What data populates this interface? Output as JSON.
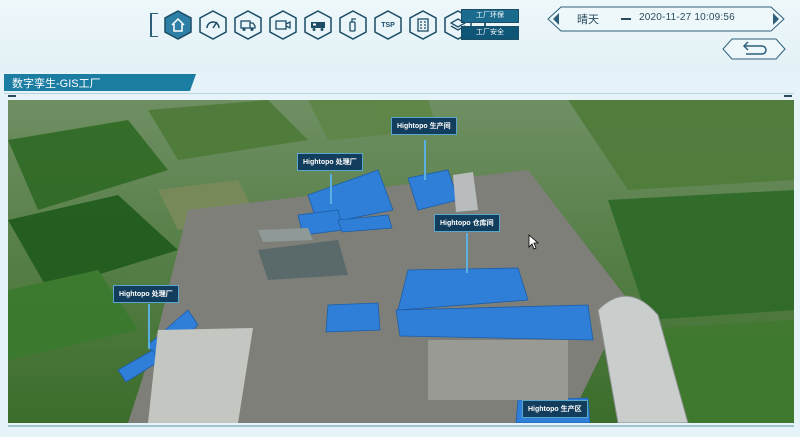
{
  "toolbar": {
    "icons": [
      "home-icon",
      "gauge-icon",
      "truck-icon",
      "camera-icon",
      "fire-truck-icon",
      "extinguisher-icon",
      "tsp-icon",
      "building-icon",
      "layers-icon"
    ],
    "tsp_label": "TSP"
  },
  "switches": {
    "env_label": "工厂环保",
    "safety_label": "工厂安全"
  },
  "status": {
    "weather": "晴天",
    "datetime": "2020-11-27 10:09:56"
  },
  "page": {
    "title": "数字孪生-GIS工厂"
  },
  "map_labels": {
    "production_hall_top": "Hightopo 生产间",
    "treatment_plant_top": "Hightopo 处理厂",
    "warehouse": "Hightopo 仓库间",
    "treatment_plant_left": "Hightopo 处理厂",
    "production_area": "Hightopo 生产区"
  },
  "colors": {
    "accent": "#1c7da3",
    "roof_blue": "#2f7fd8",
    "label_bg": "#123d5c"
  }
}
